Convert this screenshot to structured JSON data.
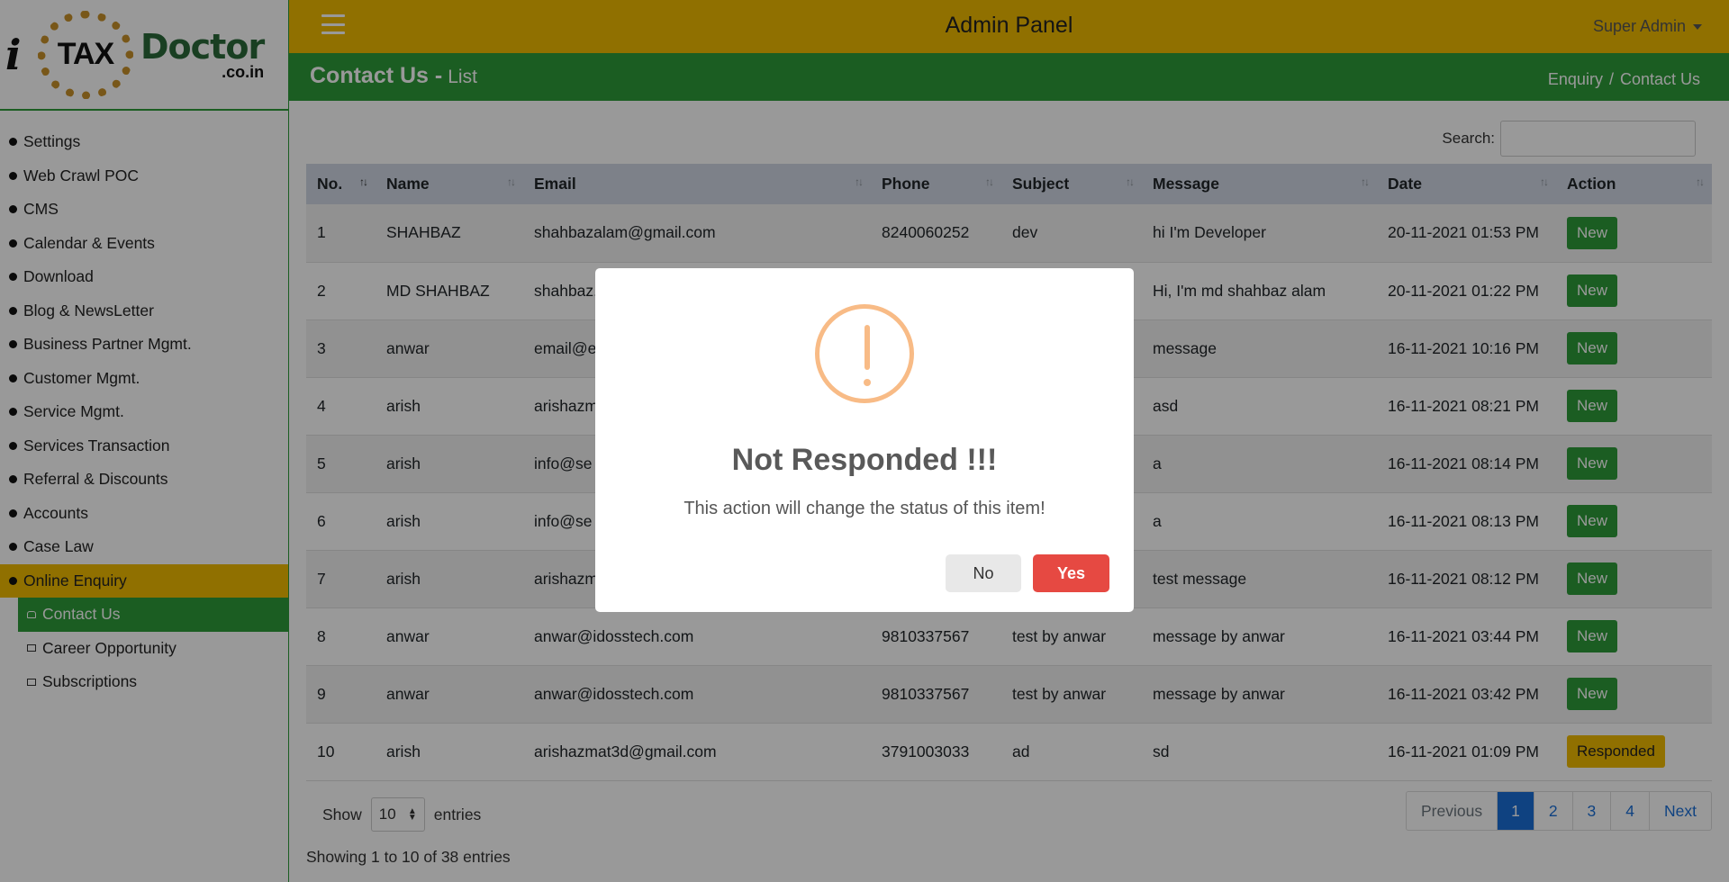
{
  "logo": {
    "i": "i",
    "tax": "TAX",
    "doctor": "Doctor",
    "domain": ".co.in"
  },
  "header": {
    "title": "Admin Panel",
    "user": "Super Admin"
  },
  "page": {
    "title": "Contact Us -",
    "subtitle": "List",
    "breadcrumb": [
      "Enquiry",
      "Contact Us"
    ]
  },
  "sidebar": {
    "items": [
      {
        "label": "Settings"
      },
      {
        "label": "Web Crawl POC"
      },
      {
        "label": "CMS"
      },
      {
        "label": "Calendar & Events"
      },
      {
        "label": "Download"
      },
      {
        "label": "Blog & NewsLetter"
      },
      {
        "label": "Business Partner Mgmt."
      },
      {
        "label": "Customer Mgmt."
      },
      {
        "label": "Service Mgmt."
      },
      {
        "label": "Services Transaction"
      },
      {
        "label": "Referral & Discounts"
      },
      {
        "label": "Accounts"
      },
      {
        "label": "Case Law"
      },
      {
        "label": "Online Enquiry"
      }
    ],
    "subitems": [
      {
        "label": "Contact Us"
      },
      {
        "label": "Career Opportunity"
      },
      {
        "label": "Subscriptions"
      }
    ]
  },
  "search": {
    "label": "Search:",
    "value": ""
  },
  "table": {
    "columns": [
      "No.",
      "Name",
      "Email",
      "Phone",
      "Subject",
      "Message",
      "Date",
      "Action"
    ],
    "rows": [
      {
        "no": "1",
        "name": "SHAHBAZ",
        "email": "shahbazalam@gmail.com",
        "phone": "8240060252",
        "subject": "dev",
        "message": "hi I'm Developer",
        "date": "20-11-2021 01:53 PM",
        "action": "New"
      },
      {
        "no": "2",
        "name": "MD SHAHBAZ",
        "email": "shahbaz.",
        "phone": "",
        "subject": "",
        "message": "Hi, I'm md shahbaz alam",
        "date": "20-11-2021 01:22 PM",
        "action": "New"
      },
      {
        "no": "3",
        "name": "anwar",
        "email": "email@e",
        "phone": "",
        "subject": "",
        "message": "message",
        "date": "16-11-2021 10:16 PM",
        "action": "New"
      },
      {
        "no": "4",
        "name": "arish",
        "email": "arishazm",
        "phone": "",
        "subject": "",
        "message": "asd",
        "date": "16-11-2021 08:21 PM",
        "action": "New"
      },
      {
        "no": "5",
        "name": "arish",
        "email": "info@se",
        "phone": "",
        "subject": "",
        "message": "a",
        "date": "16-11-2021 08:14 PM",
        "action": "New"
      },
      {
        "no": "6",
        "name": "arish",
        "email": "info@se",
        "phone": "",
        "subject": "",
        "message": "a",
        "date": "16-11-2021 08:13 PM",
        "action": "New"
      },
      {
        "no": "7",
        "name": "arish",
        "email": "arishazm",
        "phone": "",
        "subject": "",
        "message": "test message",
        "date": "16-11-2021 08:12 PM",
        "action": "New"
      },
      {
        "no": "8",
        "name": "anwar",
        "email": "anwar@idosstech.com",
        "phone": "9810337567",
        "subject": "test by anwar",
        "message": "message by anwar",
        "date": "16-11-2021 03:44 PM",
        "action": "New"
      },
      {
        "no": "9",
        "name": "anwar",
        "email": "anwar@idosstech.com",
        "phone": "9810337567",
        "subject": "test by anwar",
        "message": "message by anwar",
        "date": "16-11-2021 03:42 PM",
        "action": "New"
      },
      {
        "no": "10",
        "name": "arish",
        "email": "arishazmat3d@gmail.com",
        "phone": "3791003033",
        "subject": "ad",
        "message": "sd",
        "date": "16-11-2021 01:09 PM",
        "action": "Responded"
      }
    ]
  },
  "length": {
    "show": "Show",
    "value": "10",
    "entries": "entries"
  },
  "info": "Showing 1 to 10 of 38 entries",
  "pagination": {
    "previous": "Previous",
    "pages": [
      "1",
      "2",
      "3",
      "4"
    ],
    "next": "Next",
    "current": "1"
  },
  "modal": {
    "title": "Not Responded !!!",
    "text": "This action will change the status of this item!",
    "no": "No",
    "yes": "Yes",
    "icon": "warning-icon"
  },
  "colors": {
    "yellow": "#f1bb00",
    "green": "#2e9c3a",
    "blue": "#1a6fd8",
    "red": "#e64942",
    "warn": "#f8bb86"
  }
}
